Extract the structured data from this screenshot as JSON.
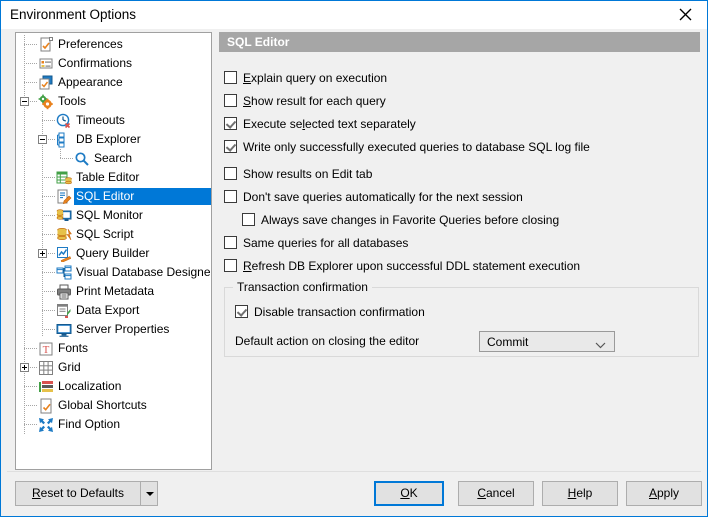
{
  "window": {
    "title": "Environment Options",
    "close_icon": "close-icon"
  },
  "tree": {
    "items": [
      {
        "label": "Preferences",
        "icon": "preferences-icon",
        "indent": 0,
        "selected": false,
        "expander": "none"
      },
      {
        "label": "Confirmations",
        "icon": "confirmations-icon",
        "indent": 0,
        "selected": false,
        "expander": "none"
      },
      {
        "label": "Appearance",
        "icon": "appearance-icon",
        "indent": 0,
        "selected": false,
        "expander": "none"
      },
      {
        "label": "Tools",
        "icon": "tools-gear-icon",
        "indent": 0,
        "selected": false,
        "expander": "minus"
      },
      {
        "label": "Timeouts",
        "icon": "timeouts-clock-icon",
        "indent": 1,
        "selected": false,
        "expander": "none"
      },
      {
        "label": "DB Explorer",
        "icon": "db-explorer-icon",
        "indent": 1,
        "selected": false,
        "expander": "minus"
      },
      {
        "label": "Search",
        "icon": "search-icon",
        "indent": 2,
        "selected": false,
        "expander": "none"
      },
      {
        "label": "Table Editor",
        "icon": "table-editor-icon",
        "indent": 1,
        "selected": false,
        "expander": "none"
      },
      {
        "label": "SQL Editor",
        "icon": "sql-editor-icon",
        "indent": 1,
        "selected": true,
        "expander": "none"
      },
      {
        "label": "SQL Monitor",
        "icon": "sql-monitor-icon",
        "indent": 1,
        "selected": false,
        "expander": "none"
      },
      {
        "label": "SQL Script",
        "icon": "sql-script-icon",
        "indent": 1,
        "selected": false,
        "expander": "none"
      },
      {
        "label": "Query Builder",
        "icon": "query-builder-icon",
        "indent": 1,
        "selected": false,
        "expander": "plus"
      },
      {
        "label": "Visual Database Designer",
        "icon": "visual-db-designer-icon",
        "indent": 1,
        "selected": false,
        "expander": "none"
      },
      {
        "label": "Print Metadata",
        "icon": "print-metadata-icon",
        "indent": 1,
        "selected": false,
        "expander": "none"
      },
      {
        "label": "Data Export",
        "icon": "data-export-icon",
        "indent": 1,
        "selected": false,
        "expander": "none"
      },
      {
        "label": "Server Properties",
        "icon": "server-properties-icon",
        "indent": 1,
        "selected": false,
        "expander": "none"
      },
      {
        "label": "Fonts",
        "icon": "fonts-icon",
        "indent": 0,
        "selected": false,
        "expander": "none"
      },
      {
        "label": "Grid",
        "icon": "grid-icon",
        "indent": 0,
        "selected": false,
        "expander": "plus"
      },
      {
        "label": "Localization",
        "icon": "localization-icon",
        "indent": 0,
        "selected": false,
        "expander": "none"
      },
      {
        "label": "Global Shortcuts",
        "icon": "global-shortcuts-icon",
        "indent": 0,
        "selected": false,
        "expander": "none"
      },
      {
        "label": "Find Option",
        "icon": "find-option-icon",
        "indent": 0,
        "selected": false,
        "expander": "none"
      }
    ]
  },
  "content": {
    "header": "SQL Editor",
    "checkboxes": [
      {
        "accel": "E",
        "rest": "xplain query on execution",
        "checked": false,
        "indent": 0
      },
      {
        "accel": "S",
        "rest": "how result for each query",
        "checked": false,
        "indent": 0
      },
      {
        "accel": "",
        "pre": "Execute se",
        "accel2": "l",
        "rest": "ected text separately",
        "checked": true,
        "indent": 0
      },
      {
        "accel": "",
        "pre": "Write only successfully executed queries to database SQL log file",
        "checked": true,
        "indent": 0
      },
      {
        "accel": "",
        "pre": "Show results on Edit tab",
        "checked": false,
        "indent": 0
      },
      {
        "accel": "",
        "pre": "Don't save queries automatically for the next session",
        "checked": false,
        "indent": 0
      },
      {
        "accel": "",
        "pre": "Always save changes in Favorite Queries before closing",
        "checked": false,
        "indent": 1
      },
      {
        "accel": "",
        "pre": "Same queries for all databases",
        "checked": false,
        "indent": 0
      },
      {
        "accel": "R",
        "rest": "efresh DB Explorer upon successful DDL statement execution",
        "checked": false,
        "indent": 0
      }
    ],
    "groupbox": {
      "title": "Transaction confirmation",
      "disable_confirmation_label": "Disable transaction confirmation",
      "disable_confirmation_checked": true,
      "default_action_label": "Default action on closing the editor",
      "combo_value": "Commit",
      "combo_arrow_icon": "chevron-down-icon"
    }
  },
  "footer": {
    "reset_accel": "R",
    "reset_rest": "eset to Defaults",
    "reset_dropdown_icon": "caret-down-icon",
    "ok_accel": "O",
    "ok_rest": "K",
    "cancel_pre": "",
    "cancel_accel": "C",
    "cancel_rest": "ancel",
    "help_accel": "H",
    "help_rest": "elp",
    "apply_accel": "A",
    "apply_rest": "pply"
  }
}
